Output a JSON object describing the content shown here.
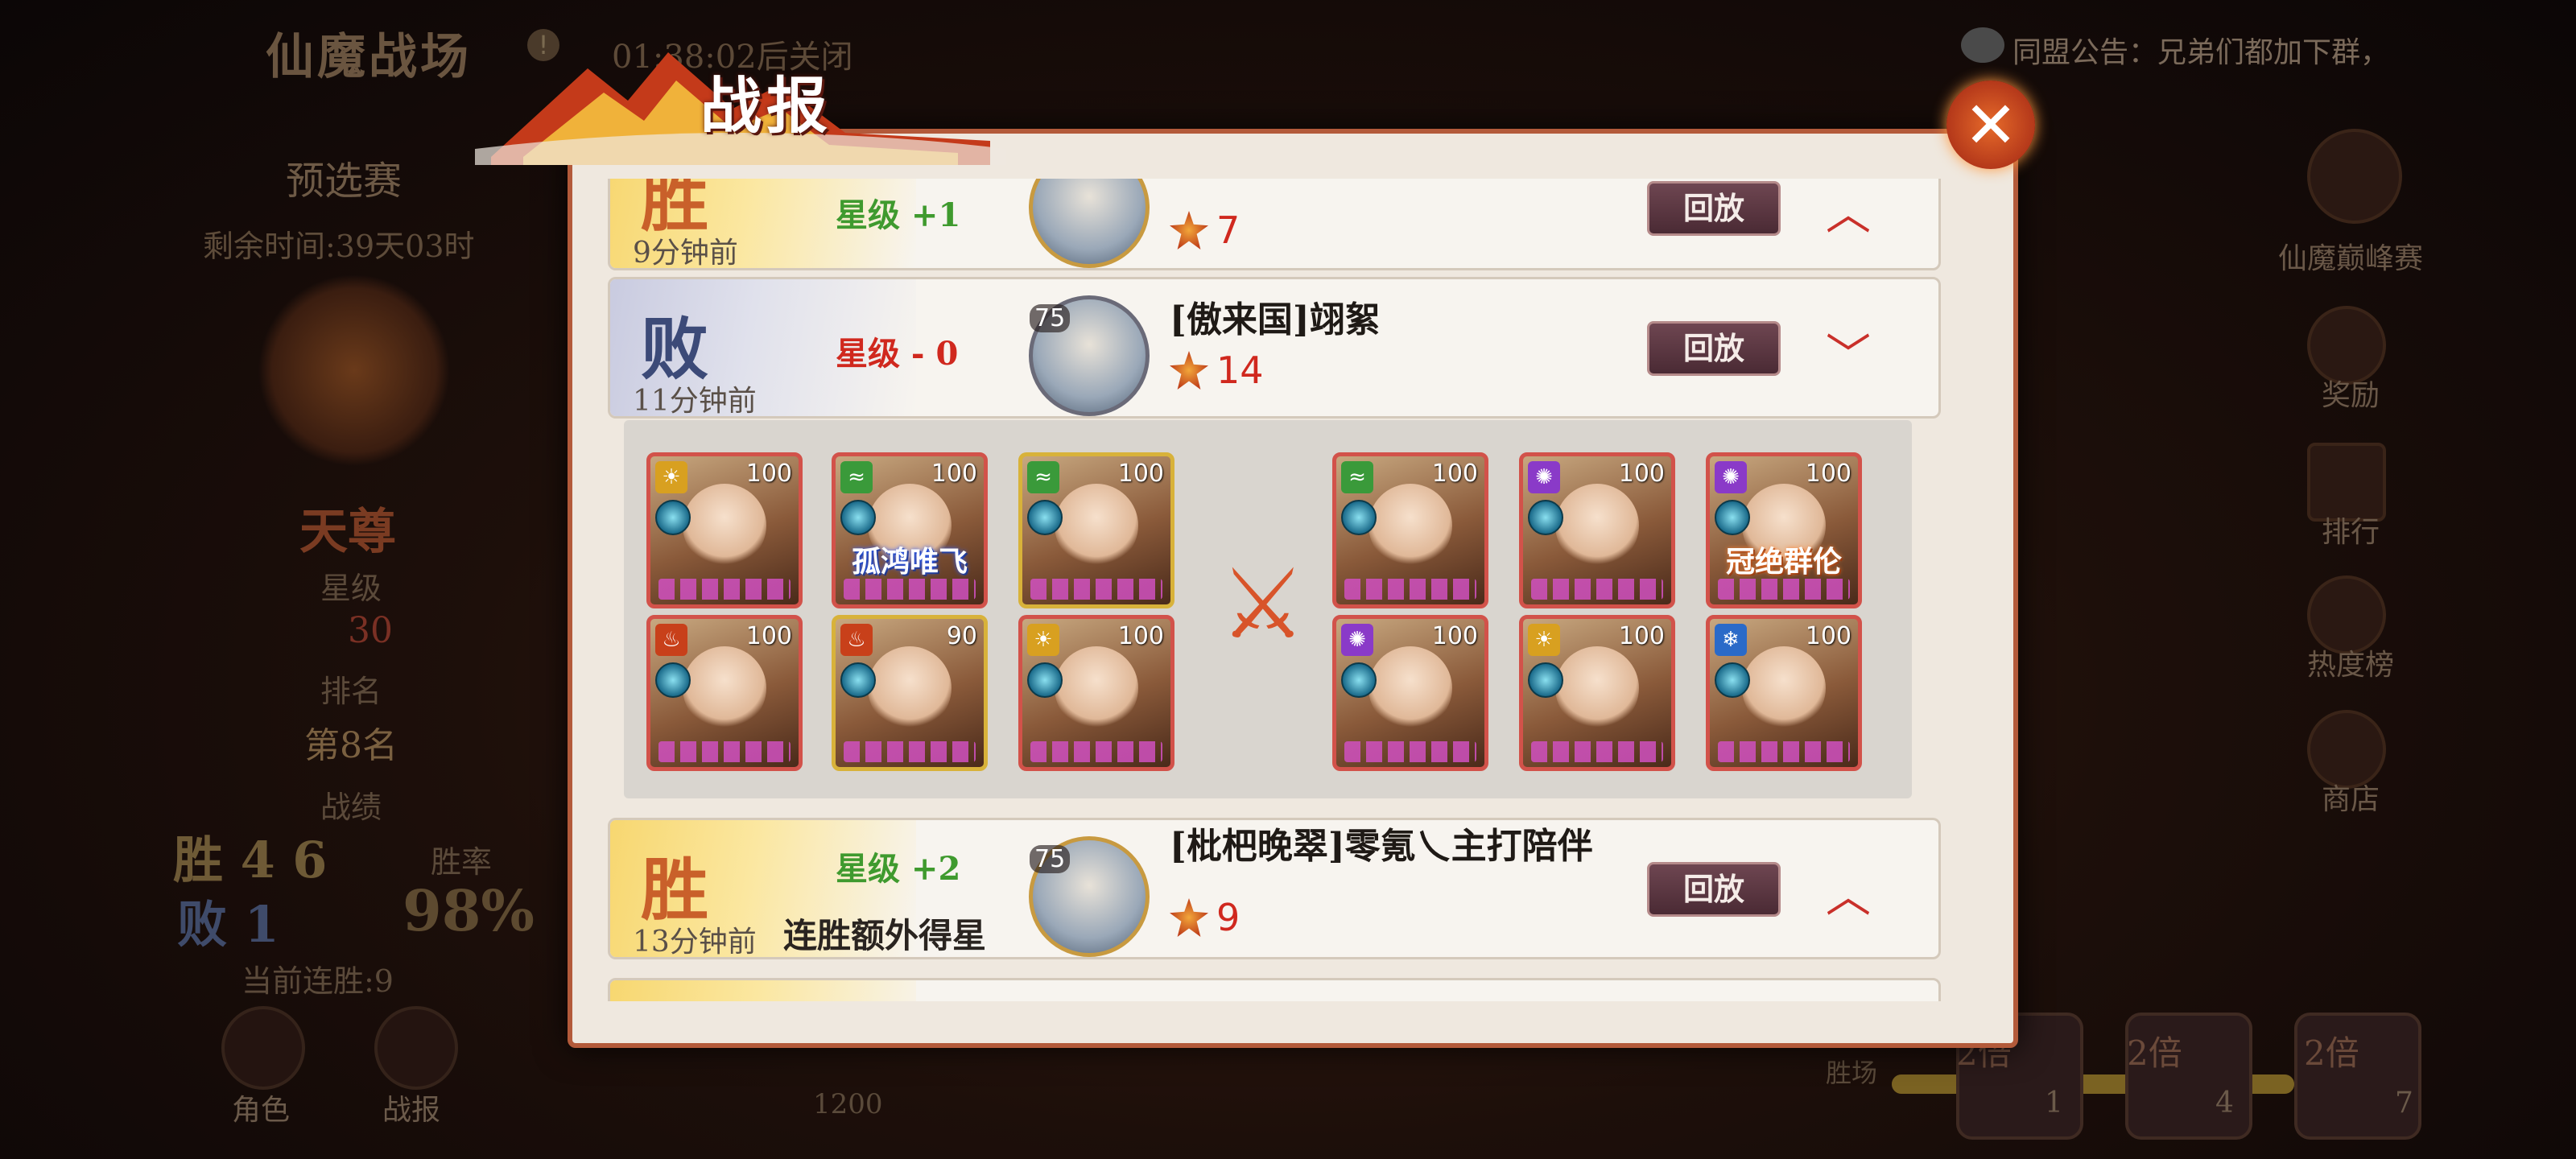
{
  "background": {
    "title": "仙魔战场",
    "timer": "01:38:02后关闭",
    "notice": "同盟公告：兄弟们都加下群，",
    "stage": "预选赛",
    "remaining": "剩余时间:39天03时",
    "rank_title": "天尊",
    "star_label": "星级",
    "star_value": "30",
    "rank_label": "排名",
    "rank_value": "第8名",
    "record_label": "战绩",
    "wins": "胜 4 6",
    "losses": "败 1",
    "winrate_label": "胜率",
    "winrate_value": "98%",
    "streak": "当前连胜:9",
    "right_menu": [
      "仙魔巅峰赛",
      "奖励",
      "排行",
      "热度榜",
      "商店"
    ],
    "bottom_nav": [
      "角色",
      "战报"
    ],
    "bottom_value": "1200",
    "bottom_label": "胜场",
    "chests": [
      {
        "mult": "2倍",
        "count": "1"
      },
      {
        "mult": "2倍",
        "count": "4"
      },
      {
        "mult": "2倍",
        "count": "7"
      }
    ]
  },
  "dialog": {
    "title": "战报",
    "close_icon": "✕"
  },
  "records": [
    {
      "result": "胜",
      "type": "win",
      "star_change": "星级 +1",
      "time": "9分钟前",
      "opponent": "",
      "level": "",
      "score": "7",
      "replay": "回放",
      "chevron": "︿"
    },
    {
      "result": "败",
      "type": "lose",
      "star_change": "星级 - 0",
      "time": "11分钟前",
      "opponent": "[傲来国]翊絮",
      "level": "75",
      "score": "14",
      "replay": "回放",
      "chevron": "﹀"
    },
    {
      "result": "胜",
      "type": "win",
      "star_change": "星级 +2",
      "extra": "连胜额外得星",
      "time": "13分钟前",
      "opponent": "[枇杷晚翠]零氪乀主打陪伴",
      "level": "75",
      "score": "9",
      "replay": "回放",
      "chevron": "︿"
    }
  ],
  "battle_detail": {
    "vs_icon": "⚔",
    "left_team": [
      {
        "level": "100",
        "elem": "☀",
        "elem_color": "#d8a020",
        "tag": ""
      },
      {
        "level": "100",
        "elem": "≈",
        "elem_color": "#3a9a3a",
        "tag": "孤鸿唯飞"
      },
      {
        "level": "100",
        "elem": "≈",
        "elem_color": "#3a9a3a",
        "tag": ""
      },
      {
        "level": "100",
        "elem": "♨",
        "elem_color": "#c8401a",
        "tag": ""
      },
      {
        "level": "90",
        "elem": "♨",
        "elem_color": "#c8401a",
        "tag": ""
      },
      {
        "level": "100",
        "elem": "☀",
        "elem_color": "#d8a020",
        "tag": ""
      }
    ],
    "right_team": [
      {
        "level": "100",
        "elem": "≈",
        "elem_color": "#3a9a3a",
        "tag": ""
      },
      {
        "level": "100",
        "elem": "✺",
        "elem_color": "#8a3ac8",
        "tag": ""
      },
      {
        "level": "100",
        "elem": "✺",
        "elem_color": "#8a3ac8",
        "tag": "冠绝群伦"
      },
      {
        "level": "100",
        "elem": "✺",
        "elem_color": "#8a3ac8",
        "tag": ""
      },
      {
        "level": "100",
        "elem": "☀",
        "elem_color": "#d8a020",
        "tag": ""
      },
      {
        "level": "100",
        "elem": "❄",
        "elem_color": "#2a6ac8",
        "tag": ""
      }
    ]
  }
}
